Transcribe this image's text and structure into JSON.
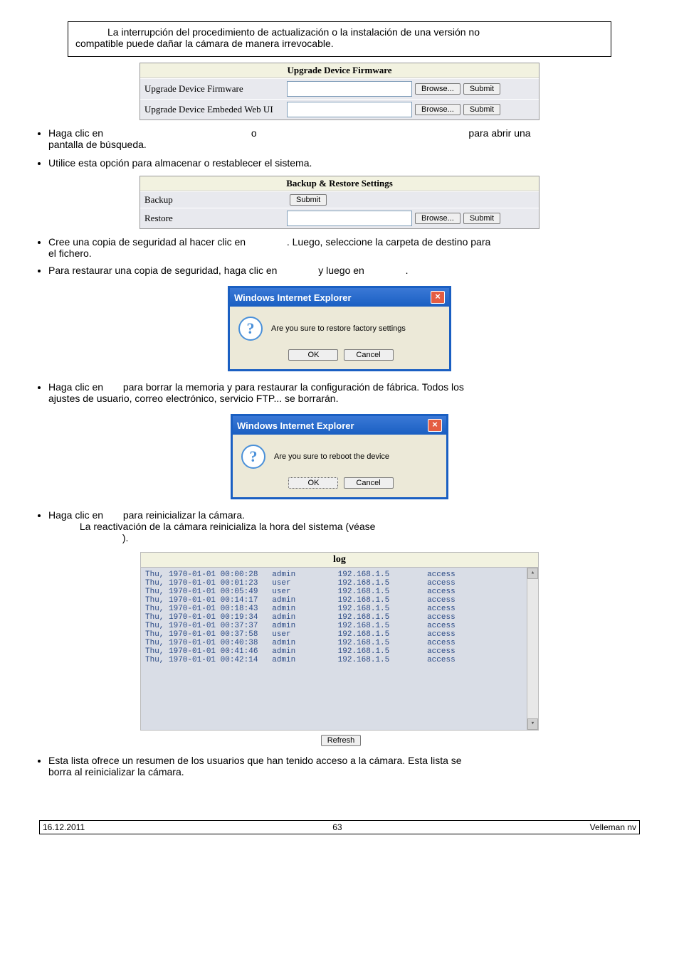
{
  "topbox": {
    "line1_indent": "La interrupción del procedimiento de actualización o la instalación de una versión no",
    "line2": "compatible puede dañar la cámara de manera irrevocable."
  },
  "upgrade_panel": {
    "title": "Upgrade Device Firmware",
    "row1": "Upgrade Device Firmware",
    "row2": "Upgrade Device Embeded Web UI",
    "browse": "Browse...",
    "submit": "Submit"
  },
  "bullets": {
    "b1a": "Haga clic en ",
    "b1b": " o ",
    "b1c": " para abrir una",
    "b1d": "pantalla de búsqueda.",
    "b2": "Utilice esta opción para almacenar o restablecer el sistema."
  },
  "backup_panel": {
    "title": "Backup & Restore Settings",
    "backup": "Backup",
    "restore": "Restore",
    "submit": "Submit",
    "browse": "Browse..."
  },
  "bullets2": {
    "b3a": "Cree una copia de seguridad al hacer clic en ",
    "b3b": ". Luego, seleccione la carpeta de destino para",
    "b3c": "el fichero.",
    "b4a": "Para restaurar una copia de seguridad, haga clic en ",
    "b4b": " y luego en ",
    "b4c": "."
  },
  "dialog1": {
    "title": "Windows Internet Explorer",
    "msg": "Are you sure to restore factory settings",
    "ok": "OK",
    "cancel": "Cancel"
  },
  "bullets3": {
    "b5a": "Haga clic en ",
    "b5b": " para borrar la memoria y para restaurar la configuración de fábrica. Todos los",
    "b5c": "ajustes de usuario, correo electrónico, servicio FTP... se borrarán."
  },
  "dialog2": {
    "title": "Windows Internet Explorer",
    "msg": "Are you sure to reboot the device",
    "ok": "OK",
    "cancel": "Cancel"
  },
  "bullets4": {
    "b6a": "Haga clic en ",
    "b6b": " para reinicializar la cámara.",
    "b6c": "La reactivación de la cámara reinicializa la hora del sistema (véase",
    "b6d": ")."
  },
  "log": {
    "title": "log",
    "rows": [
      "Thu, 1970-01-01 00:00:28   admin         192.168.1.5        access",
      "Thu, 1970-01-01 00:01:23   user          192.168.1.5        access",
      "Thu, 1970-01-01 00:05:49   user          192.168.1.5        access",
      "Thu, 1970-01-01 00:14:17   admin         192.168.1.5        access",
      "Thu, 1970-01-01 00:18:43   admin         192.168.1.5        access",
      "Thu, 1970-01-01 00:19:34   admin         192.168.1.5        access",
      "Thu, 1970-01-01 00:37:37   admin         192.168.1.5        access",
      "Thu, 1970-01-01 00:37:58   user          192.168.1.5        access",
      "Thu, 1970-01-01 00:40:38   admin         192.168.1.5        access",
      "Thu, 1970-01-01 00:41:46   admin         192.168.1.5        access",
      "Thu, 1970-01-01 00:42:14   admin         192.168.1.5        access"
    ],
    "refresh": "Refresh"
  },
  "bullets5": {
    "b7a": "Esta lista ofrece un resumen de los usuarios que han tenido acceso a la cámara. Esta lista se",
    "b7b": "borra al reinicializar la cámara."
  },
  "footer": {
    "date": "16.12.2011",
    "page": "63",
    "brand": "Velleman nv"
  }
}
